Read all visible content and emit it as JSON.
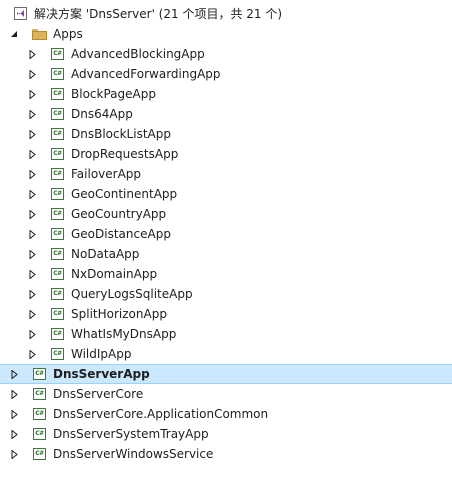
{
  "solution": {
    "label": "解决方案 'DnsServer' (21 个项目，共 21 个)",
    "icon": "solution-icon"
  },
  "folder": {
    "label": "Apps",
    "icon": "folder-icon",
    "expanded": true
  },
  "apps": [
    {
      "label": "AdvancedBlockingApp"
    },
    {
      "label": "AdvancedForwardingApp"
    },
    {
      "label": "BlockPageApp"
    },
    {
      "label": "Dns64App"
    },
    {
      "label": "DnsBlockListApp"
    },
    {
      "label": "DropRequestsApp"
    },
    {
      "label": "FailoverApp"
    },
    {
      "label": "GeoContinentApp"
    },
    {
      "label": "GeoCountryApp"
    },
    {
      "label": "GeoDistanceApp"
    },
    {
      "label": "NoDataApp"
    },
    {
      "label": "NxDomainApp"
    },
    {
      "label": "QueryLogsSqliteApp"
    },
    {
      "label": "SplitHorizonApp"
    },
    {
      "label": "WhatIsMyDnsApp"
    },
    {
      "label": "WildIpApp"
    }
  ],
  "projects": [
    {
      "label": "DnsServerApp",
      "selected": true
    },
    {
      "label": "DnsServerCore"
    },
    {
      "label": "DnsServerCore.ApplicationCommon"
    },
    {
      "label": "DnsServerSystemTrayApp"
    },
    {
      "label": "DnsServerWindowsService"
    }
  ],
  "icon_text": "C#",
  "colors": {
    "selection_bg": "#cce8ff",
    "selection_border": "#99d1ff",
    "cs_green": "#2f6f2f",
    "folder": "#dcb35c"
  }
}
